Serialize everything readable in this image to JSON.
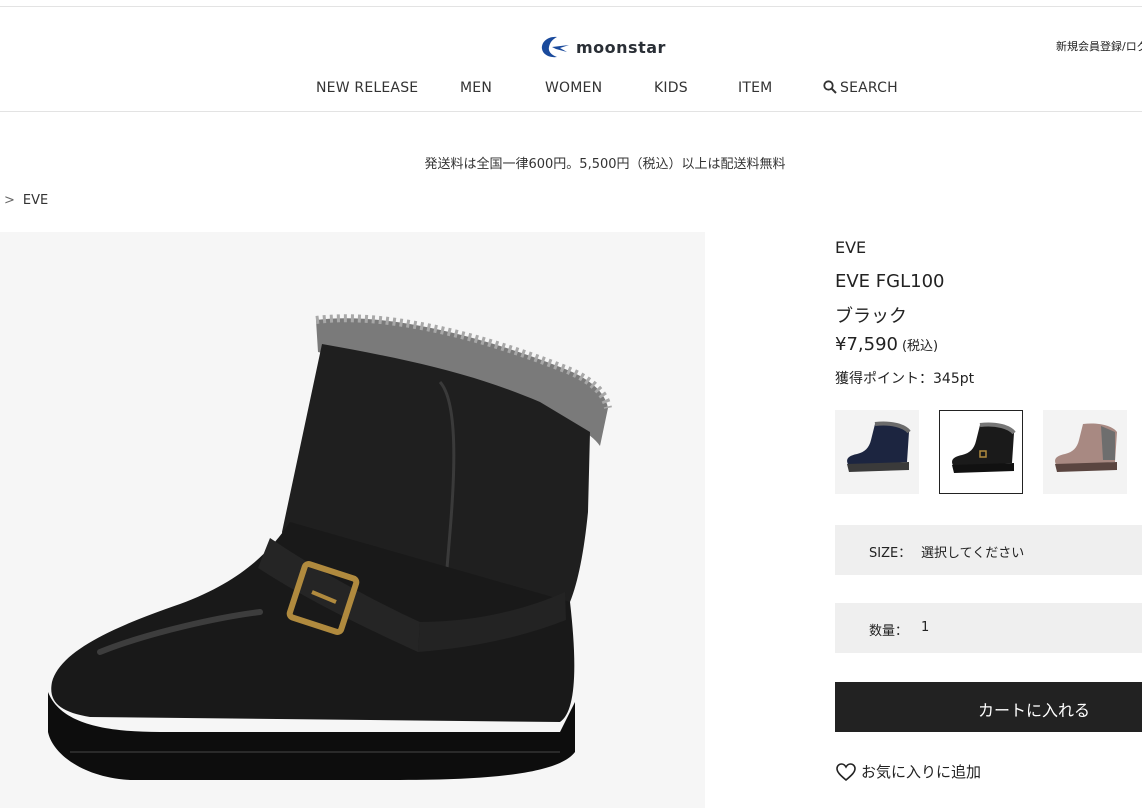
{
  "header": {
    "logo_text": "moonstar",
    "account_link": "新規会員登録/ログ",
    "nav": [
      "NEW RELEASE",
      "MEN",
      "WOMEN",
      "KIDS",
      "ITEM"
    ],
    "search_label": "SEARCH",
    "search_icon": "search-icon"
  },
  "notice": "発送料は全国一律600円。5,500円（税込）以上は配送料無料",
  "breadcrumb": {
    "separator": ">",
    "current": "EVE"
  },
  "product": {
    "brand": "EVE",
    "name": "EVE FGL100",
    "color": "ブラック",
    "price": "¥7,590",
    "tax_note": "(税込)",
    "points": "獲得ポイント：345pt",
    "swatches": [
      {
        "name": "navy",
        "selected": false
      },
      {
        "name": "black",
        "selected": true
      },
      {
        "name": "pink-beige",
        "selected": false
      }
    ]
  },
  "size": {
    "label": "SIZE：",
    "value": "選択してください"
  },
  "quantity": {
    "label": "数量：",
    "value": "1"
  },
  "cart_button": "カートに入れる",
  "favorite": {
    "label": "お気に入りに追加",
    "icon": "heart-icon"
  },
  "colors": {
    "brand_blue": "#1a4a9c",
    "button_dark": "#222222",
    "select_bg": "#efefef"
  }
}
